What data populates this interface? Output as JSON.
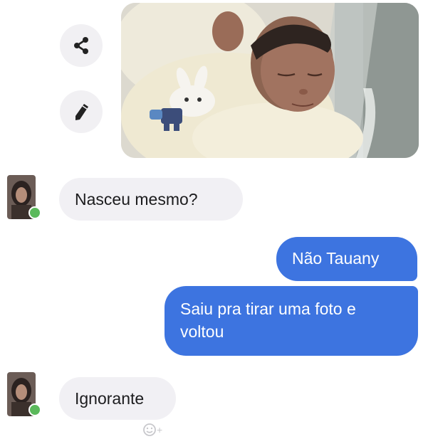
{
  "messages": [
    {
      "from": "contact",
      "text": "Nasceu mesmo?"
    },
    {
      "from": "me",
      "text": "Não Tauany"
    },
    {
      "from": "me",
      "text": "Saiu pra tirar uma foto e voltou"
    },
    {
      "from": "contact",
      "text": "Ignorante"
    }
  ],
  "photo_actions": {
    "share_icon": "share-icon",
    "edit_icon": "pencil-icon"
  },
  "reaction": {
    "icon": "smiley-add-icon",
    "plus": "+"
  },
  "colors": {
    "outgoing_bubble": "#3d74e0",
    "incoming_bubble": "#f1f0f4",
    "online_dot": "#5bb95b"
  }
}
